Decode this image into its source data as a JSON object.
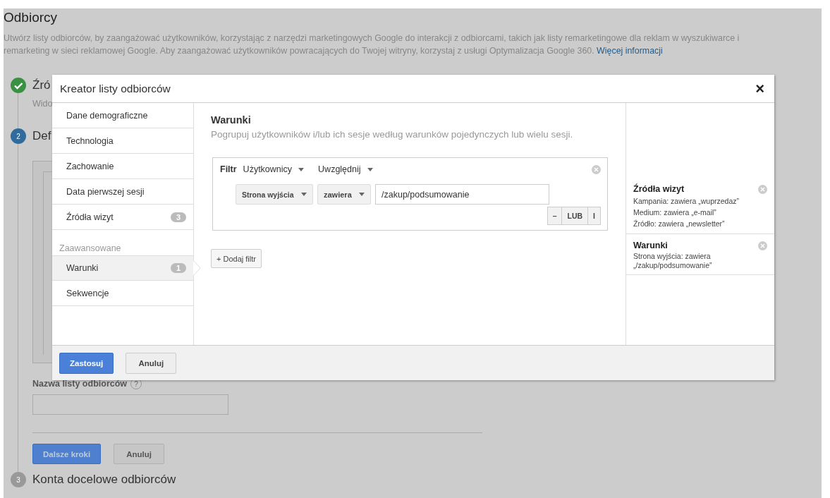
{
  "page": {
    "title": "Odbiorcy",
    "description": "Utwórz listy odbiorców, by zaangażować użytkowników, korzystając z narzędzi marketingowych Google do interakcji z odbiorcami, takich jak listy remarketingowe dla reklam w wyszukiwarce i remarketing w sieci reklamowej Google. Aby zaangażować użytkowników powracających do Twojej witryny, korzystaj z usługi Optymalizacja Google 360.",
    "link": "Więcej informacji"
  },
  "steps": [
    {
      "kind": "done",
      "title": "Źró",
      "subtitle": "Wido"
    },
    {
      "kind": "active",
      "number": "2",
      "title": "Def",
      "name_label": "Nazwa listy odbiorców",
      "help": "?",
      "buttons": [
        {
          "label": "Dalsze kroki",
          "kind": "primary"
        },
        {
          "label": "Anuluj",
          "kind": "secondary"
        }
      ]
    },
    {
      "kind": "pending",
      "number": "3",
      "title": "Konta docelowe odbiorców"
    }
  ],
  "modal": {
    "title": "Kreator listy odbiorców",
    "close": "×",
    "nav": [
      {
        "kind": "item",
        "label": "Dane demograficzne",
        "selected": false
      },
      {
        "kind": "item",
        "label": "Technologia",
        "selected": false
      },
      {
        "kind": "item",
        "label": "Zachowanie",
        "selected": false
      },
      {
        "kind": "item",
        "label": "Data pierwszej sesji",
        "selected": false
      },
      {
        "kind": "item",
        "label": "Źródła wizyt",
        "badge": "3",
        "selected": false
      },
      {
        "kind": "section",
        "label": "Zaawansowane"
      },
      {
        "kind": "item",
        "label": "Warunki",
        "badge": "1",
        "selected": true
      },
      {
        "kind": "item",
        "label": "Sekwencje",
        "selected": false
      }
    ],
    "heading": "Warunki",
    "subheading": "Pogrupuj użytkowników i/lub ich sesje według warunków pojedynczych lub wielu sesji.",
    "filter": {
      "label": "Filtr",
      "scope": "Użytkownicy",
      "mode": "Uwzględnij",
      "dimension": "Strona wyjścia",
      "operator": "zawiera",
      "value": "/zakup/podsumowanie",
      "actions": [
        "–",
        "LUB",
        "I"
      ]
    },
    "add_filter": "+ Dodaj filtr",
    "summary": [
      {
        "title": "Źródła wizyt",
        "lines": [
          "Kampania: zawiera „wuprzedaz”",
          "Medium: zawiera „e-mail”",
          "Źródło: zawiera „newsletter”"
        ]
      },
      {
        "title": "Warunki",
        "lines": [
          "Strona wyjścia: zawiera „/zakup/podsumowanie”"
        ]
      }
    ],
    "buttons": [
      {
        "label": "Zastosuj",
        "kind": "primary"
      },
      {
        "label": "Anuluj",
        "kind": "secondary"
      }
    ]
  }
}
